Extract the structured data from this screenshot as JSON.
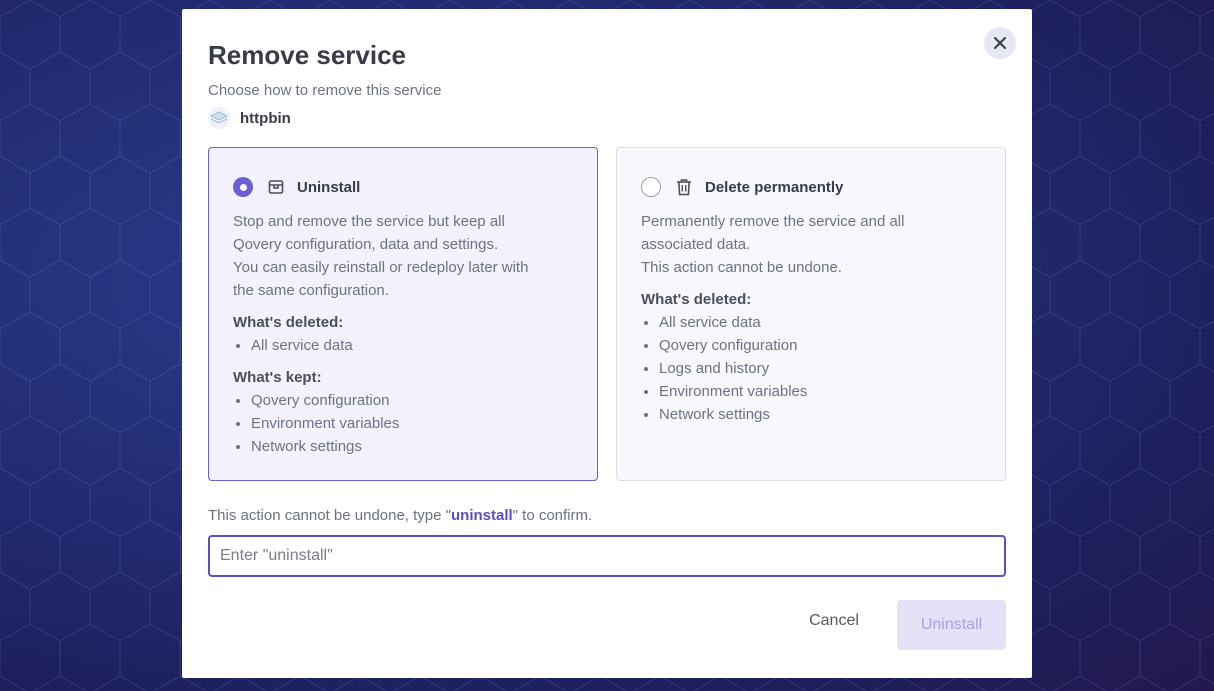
{
  "modal": {
    "title": "Remove service",
    "subtitle": "Choose how to remove this service",
    "service_name": "httpbin",
    "close_icon": "close-icon"
  },
  "options": {
    "uninstall": {
      "selected": true,
      "icon": "package-icon",
      "title": "Uninstall",
      "description": [
        "Stop and remove the service but keep all",
        "Qovery configuration, data and settings.",
        "You can easily reinstall or redeploy later with",
        "the same configuration."
      ],
      "deleted_title": "What's deleted:",
      "deleted_items": [
        "All service data"
      ],
      "kept_title": "What's kept:",
      "kept_items": [
        "Qovery configuration",
        "Environment variables",
        "Network settings"
      ]
    },
    "delete": {
      "selected": false,
      "icon": "trash-icon",
      "title": "Delete permanently",
      "description": [
        "Permanently remove the service and all",
        "associated data.",
        "This action cannot be undone."
      ],
      "deleted_title": "What's deleted:",
      "deleted_items": [
        "All service data",
        "Qovery configuration",
        "Logs and history",
        "Environment variables",
        "Network settings"
      ]
    }
  },
  "confirm": {
    "prefix": "This action cannot be undone, type \"",
    "keyword": "uninstall",
    "suffix": "\" to confirm.",
    "placeholder": "Enter \"uninstall\"",
    "value": ""
  },
  "actions": {
    "cancel_label": "Cancel",
    "submit_label": "Uninstall"
  },
  "colors": {
    "accent": "#6b5fd3",
    "submit_disabled_bg": "#e5e2f8",
    "submit_disabled_text": "#a8a1e6"
  }
}
